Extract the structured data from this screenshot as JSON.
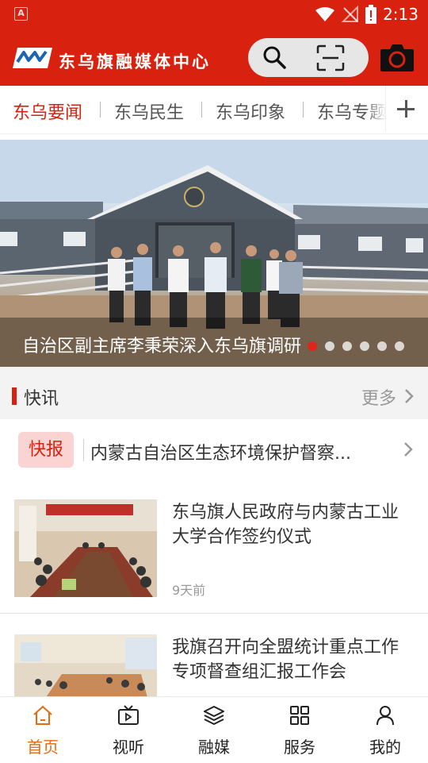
{
  "status_bar": {
    "time": "2:13",
    "app_icon_letter": "A"
  },
  "header": {
    "brand_name": "东乌旗融媒体中心",
    "search_icon": "search-icon",
    "scan_icon": "scan-icon",
    "camera_icon": "camera-icon",
    "colors": {
      "primary": "#d8210f"
    }
  },
  "tabs": [
    {
      "label": "东乌要闻",
      "active": true
    },
    {
      "label": "东乌民生",
      "active": false
    },
    {
      "label": "东乌印象",
      "active": false
    },
    {
      "label": "东乌专题",
      "active": false
    }
  ],
  "banner": {
    "caption": "自治区副主席李秉荣深入东乌旗调研",
    "slide_count": 6,
    "active_slide": 1
  },
  "section": {
    "title": "快讯",
    "more_label": "更多"
  },
  "flash": {
    "badge": "快报",
    "text": "内蒙古自治区生态环境保护督察..."
  },
  "news": [
    {
      "title": "东乌旗人民政府与内蒙古工业大学合作签约仪式",
      "meta": "9天前"
    },
    {
      "title": "我旗召开向全盟统计重点工作专项督查组汇报工作会",
      "meta": ""
    }
  ],
  "bottom_nav": [
    {
      "label": "首页",
      "icon": "home-icon",
      "active": true
    },
    {
      "label": "视听",
      "icon": "tv-icon",
      "active": false
    },
    {
      "label": "融媒",
      "icon": "layers-icon",
      "active": false
    },
    {
      "label": "服务",
      "icon": "grid-icon",
      "active": false
    },
    {
      "label": "我的",
      "icon": "user-icon",
      "active": false
    }
  ]
}
